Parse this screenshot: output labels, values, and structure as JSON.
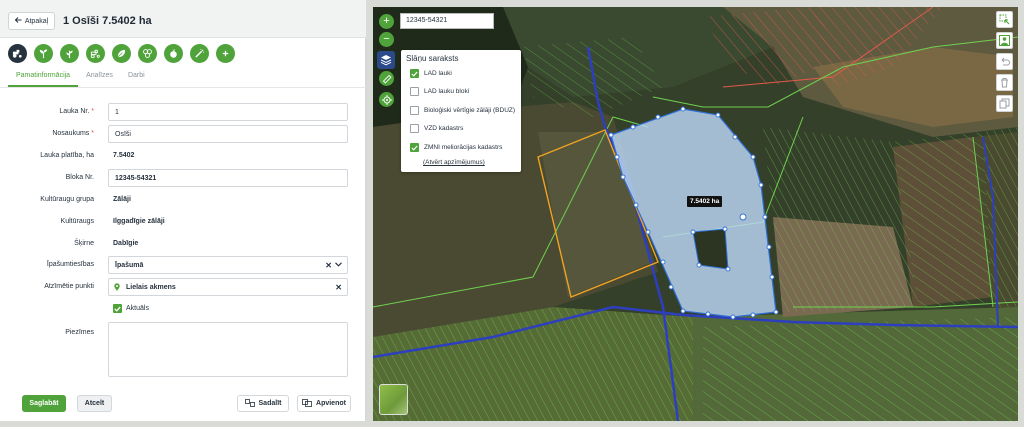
{
  "header": {
    "back_label": "Atpakaļ",
    "title": "1 Osīši 7.5402 ha"
  },
  "tabs": [
    {
      "label": "Pamatinformācija",
      "active": true
    },
    {
      "label": "Analīzes",
      "active": false
    },
    {
      "label": "Darbi",
      "active": false
    }
  ],
  "tool_icons": [
    "tractor-icon",
    "seedling-icon",
    "plant-icon",
    "tractor-outline-icon",
    "leaf-icon",
    "molecule-icon",
    "apple-icon",
    "spray-icon",
    "plus-icon"
  ],
  "form": {
    "field_number": {
      "label": "Lauka Nr.",
      "required": true,
      "value": "1"
    },
    "name": {
      "label": "Nosaukums",
      "required": true,
      "value": "Osīši"
    },
    "area": {
      "label": "Lauka platība, ha",
      "value": "7.5402"
    },
    "block": {
      "label": "Bloka Nr.",
      "value": "12345-54321"
    },
    "crop_group": {
      "label": "Kultūraugu grupa",
      "value": "Zālāji"
    },
    "crop": {
      "label": "Kultūraugs",
      "value": "Ilggadīgie zālāji"
    },
    "variety": {
      "label": "Šķirne",
      "value": "Dabīgie"
    },
    "ownership": {
      "label": "Īpašumtiesības",
      "value": "Īpašumā"
    },
    "points": {
      "label": "Atzīmētie punkti",
      "value": "Lielais akmens"
    },
    "current": {
      "label": "Aktuāls",
      "checked": true
    },
    "notes": {
      "label": "Piezīmes",
      "value": ""
    }
  },
  "footer": {
    "save": "Saglabāt",
    "cancel": "Atcelt",
    "split": "Sadalīt",
    "merge": "Apvienot"
  },
  "map": {
    "search_value": "12345-54321",
    "area_label": "7.5402 ha",
    "layers": {
      "title": "Slāņu saraksts",
      "items": [
        {
          "label": "LAD lauki",
          "checked": true
        },
        {
          "label": "LAD lauku bloki",
          "checked": false
        },
        {
          "label": "Bioloģiski vērtīgie zālāji (BDUZ)",
          "checked": false
        },
        {
          "label": "VZD kadastrs",
          "checked": false
        },
        {
          "label": "ZMNI meliorācijas kadastrs",
          "checked": true
        }
      ],
      "link": "(Atvērt apzīmējumus)"
    },
    "left_controls": [
      "zoom-in-icon",
      "zoom-out-icon",
      "layers-icon",
      "ruler-icon",
      "locate-icon"
    ],
    "right_controls": [
      "select-area-icon",
      "user-location-icon",
      "undo-icon",
      "delete-icon",
      "copy-icon"
    ]
  },
  "colors": {
    "accent": "#4fa33a",
    "dark": "#26323e",
    "field_fill": "#bcd8f6",
    "field_outline": "#2f6fd6",
    "orange_field": "#f0a321",
    "drainage_green": "#6fd14f",
    "drainage_red": "#e25a4a",
    "road_blue": "#2d3fbf"
  }
}
